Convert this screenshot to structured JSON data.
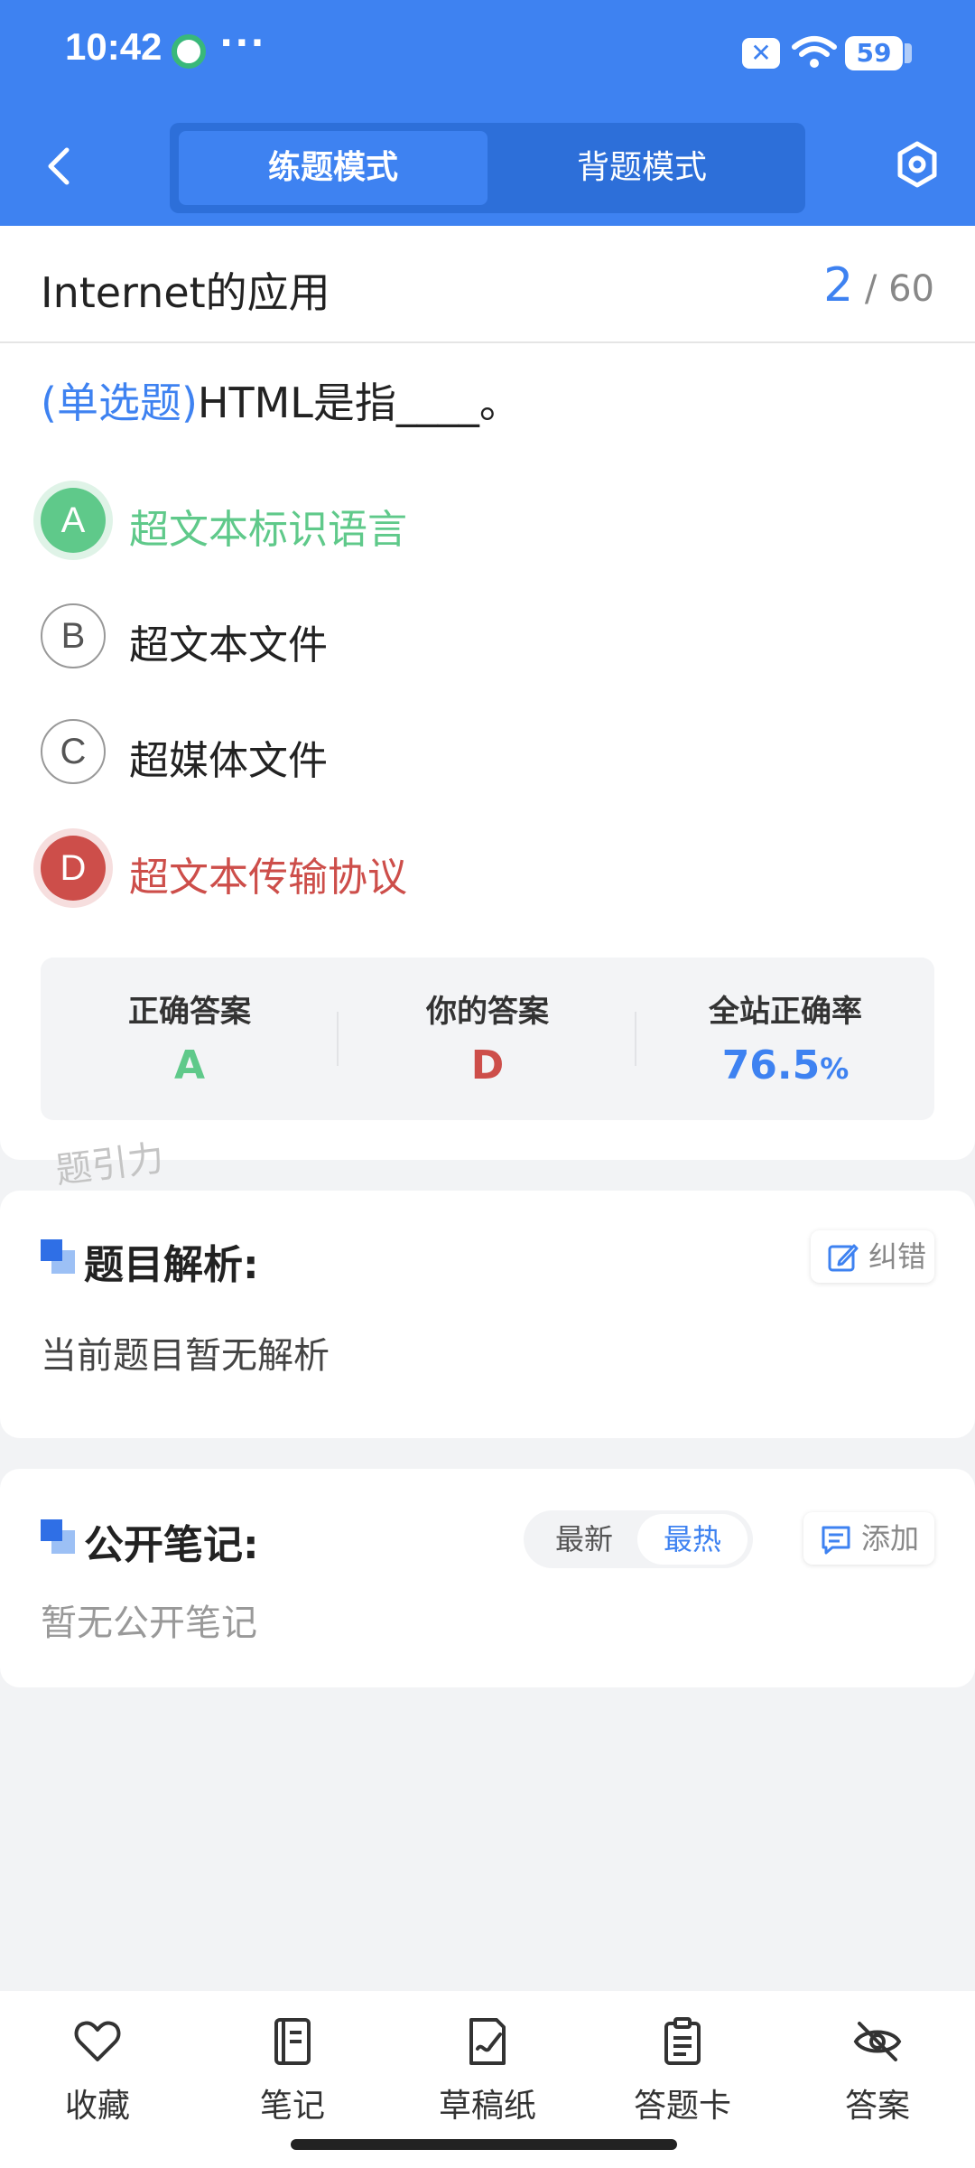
{
  "status_bar": {
    "time": "10:42",
    "dots": "···",
    "battery": "59"
  },
  "header": {
    "tabs": [
      {
        "label": "练题模式",
        "active": true
      },
      {
        "label": "背题模式",
        "active": false
      }
    ],
    "icons": {
      "back": "chevron-left-icon",
      "settings": "hexagon-settings-icon"
    }
  },
  "question": {
    "chapter": "Internet的应用",
    "current": "2",
    "total": "/ 60",
    "type": "(单选题)",
    "stem": "HTML是指____。",
    "options": [
      {
        "letter": "A",
        "text": "超文本标识语言",
        "state": "correct"
      },
      {
        "letter": "B",
        "text": "超文本文件",
        "state": "normal"
      },
      {
        "letter": "C",
        "text": "超媒体文件",
        "state": "normal"
      },
      {
        "letter": "D",
        "text": "超文本传输协议",
        "state": "wrong"
      }
    ],
    "answer_summary": {
      "correct_label": "正确答案",
      "correct_value": "A",
      "yours_label": "你的答案",
      "yours_value": "D",
      "rate_label": "全站正确率",
      "rate_value": "76.5",
      "rate_unit": "%"
    },
    "watermark": "题引力"
  },
  "analysis": {
    "title": "题目解析:",
    "body": "当前题目暂无解析",
    "action": "纠错"
  },
  "notes": {
    "title": "公开笔记:",
    "sort_options": [
      "最新",
      "最热"
    ],
    "sort_selected": "最热",
    "action": "添加",
    "body": "暂无公开笔记"
  },
  "bottom_nav": [
    {
      "label": "收藏",
      "icon": "heart-icon"
    },
    {
      "label": "笔记",
      "icon": "notebook-icon"
    },
    {
      "label": "草稿纸",
      "icon": "draft-paper-icon"
    },
    {
      "label": "答题卡",
      "icon": "answer-card-icon"
    },
    {
      "label": "答案",
      "icon": "eye-off-icon"
    }
  ],
  "colors": {
    "primary": "#3e82f1",
    "correct": "#5fc98a",
    "wrong": "#cd4e4a",
    "background": "#f2f3f5"
  }
}
